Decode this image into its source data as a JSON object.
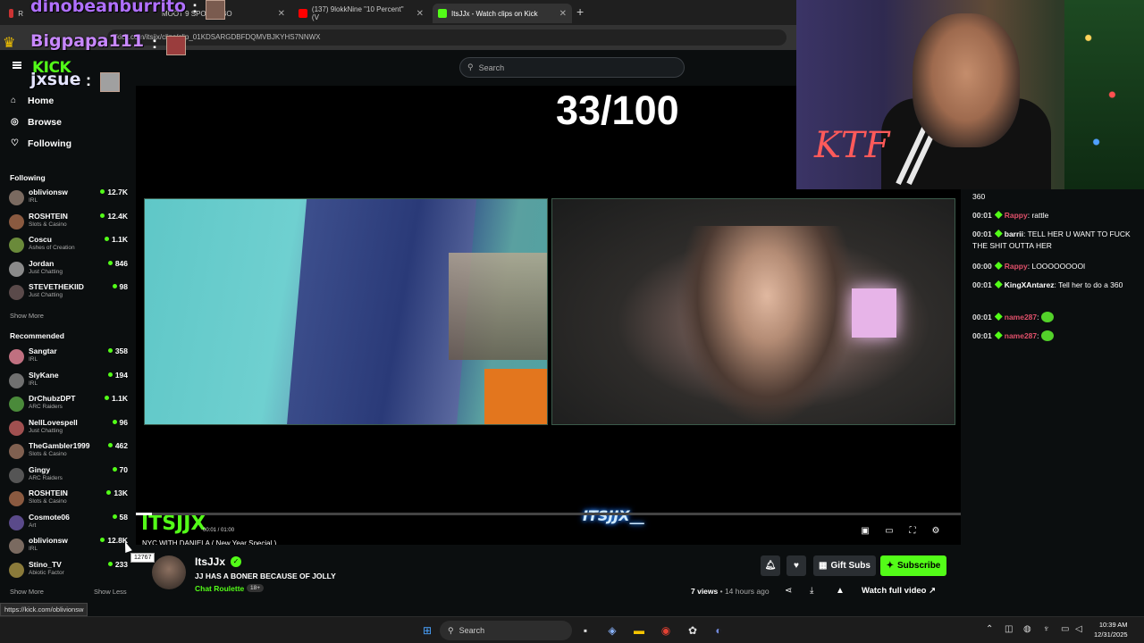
{
  "browser": {
    "tabs": [
      {
        "label": "R"
      },
      {
        "label": "MOOT 9 SPONGEBO"
      },
      {
        "label": "(137) 9lokkNine \"10 Percent\" (V"
      },
      {
        "label": "ItsJJx - Watch clips on Kick"
      }
    ],
    "url": "kick.com/itsjjx/clips/clip_01KDSARGDBFDQMVBJKYHS7NNWX"
  },
  "overlay": {
    "user1": "dinobeanburrito",
    "user2": "Bigpapa111",
    "user3": "jxsue",
    "colon": ":"
  },
  "header": {
    "logo": "KICK",
    "search_placeholder": "Search"
  },
  "sidebar": {
    "nav": [
      {
        "label": "Home",
        "icon": "home-icon"
      },
      {
        "label": "Browse",
        "icon": "compass-icon"
      },
      {
        "label": "Following",
        "icon": "heart-icon"
      }
    ],
    "following_title": "Following",
    "following": [
      {
        "name": "oblivionsw",
        "category": "IRL",
        "viewers": "12.7K",
        "color": "#7a6a60"
      },
      {
        "name": "ROSHTEIN",
        "category": "Slots & Casino",
        "viewers": "12.4K",
        "color": "#8a5a40"
      },
      {
        "name": "Coscu",
        "category": "Ashes of Creation",
        "viewers": "1.1K",
        "color": "#6a8a3a"
      },
      {
        "name": "Jordan",
        "category": "Just Chatting",
        "viewers": "846",
        "color": "#8a8a8a"
      },
      {
        "name": "STEVETHEKIID",
        "category": "Just Chatting",
        "viewers": "98",
        "color": "#5a4a4a"
      }
    ],
    "show_more_1": "Show More",
    "recommended_title": "Recommended",
    "recommended": [
      {
        "name": "Sangtar",
        "category": "IRL",
        "viewers": "358",
        "color": "#c07080"
      },
      {
        "name": "SlyKane",
        "category": "IRL",
        "viewers": "194",
        "color": "#707070"
      },
      {
        "name": "DrChubzDPT",
        "category": "ARC Raiders",
        "viewers": "1.1K",
        "color": "#4a8a3a"
      },
      {
        "name": "NellLovespell",
        "category": "Just Chatting",
        "viewers": "96",
        "color": "#a05050"
      },
      {
        "name": "TheGambler1999",
        "category": "Slots & Casino",
        "viewers": "462",
        "color": "#806050"
      },
      {
        "name": "Gingy",
        "category": "ARC Raiders",
        "viewers": "70",
        "color": "#555"
      },
      {
        "name": "ROSHTEIN",
        "category": "Slots & Casino",
        "viewers": "13K",
        "color": "#8a5a40"
      },
      {
        "name": "Cosmote06",
        "category": "Art",
        "viewers": "58",
        "color": "#5a4a8a"
      },
      {
        "name": "oblivionsw",
        "category": "IRL",
        "viewers": "12.8K",
        "color": "#7a6a60"
      },
      {
        "name": "Stino_TV",
        "category": "Abiotic Factor",
        "viewers": "233",
        "color": "#8a7a3a"
      }
    ],
    "show_more_2": "Show More",
    "show_less": "Show Less"
  },
  "video": {
    "counter": "33/100",
    "watermark": "ITSJJX",
    "tiktok": "ITSJJX__",
    "time": "00:01 / 01:00",
    "title": "NYC WITH DANIELA ( New Year Special )",
    "progress": 0.02
  },
  "clip": {
    "channel": "ItsJJx",
    "title": "JJ HAS A BONER BECAUSE OF JOLLY",
    "category": "Chat Roulette",
    "age": "18+",
    "views": "7 views",
    "time_ago": "14 hours ago",
    "gift_subs": "Gift Subs",
    "subscribe": "Subscribe",
    "watch_full": "Watch full video"
  },
  "webcam": {
    "overlay_text": "KTF"
  },
  "chat": {
    "messages": [
      {
        "time": "",
        "user": "",
        "text": "360",
        "color": "#fff"
      },
      {
        "time": "00:01",
        "user": "Rappy",
        "text": "rattle",
        "color": "#e0506a"
      },
      {
        "time": "00:01",
        "user": "barrii",
        "text": "TELL HER U WANT TO FUCK THE SHIT OUTTA HER",
        "color": "#fff"
      },
      {
        "time": "00:00",
        "user": "Rappy",
        "text": "LOOOOOOOOl",
        "color": "#e0506a"
      },
      {
        "time": "00:01",
        "user": "KingXAntarez",
        "text": "Tell her to do a 360",
        "color": "#fff"
      },
      {
        "time": "00:01",
        "user": "name287",
        "text": "",
        "color": "#e0506a"
      },
      {
        "time": "00:01",
        "user": "name287",
        "text": "",
        "color": "#e0506a"
      }
    ]
  },
  "status": {
    "hover_url": "https://kick.com/oblivionsw",
    "tooltip": "12767"
  },
  "taskbar": {
    "search": "Search",
    "time": "10:39 AM",
    "date": "12/31/2025"
  },
  "colors": {
    "accent": "#53fc18"
  }
}
